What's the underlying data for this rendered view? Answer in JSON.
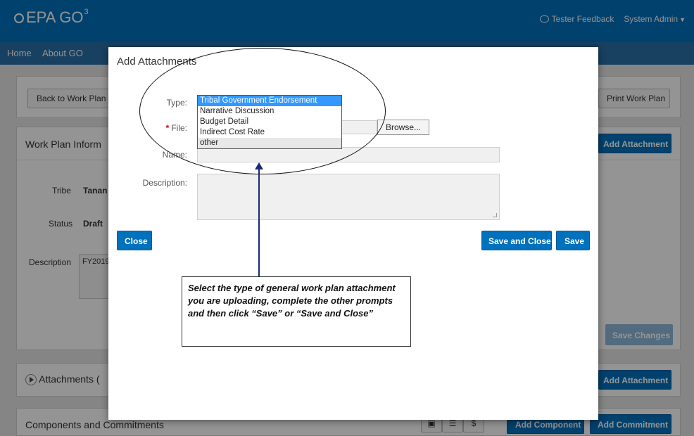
{
  "header": {
    "logo_text": "EPA GO",
    "logo_sup": "3",
    "feedback_label": "Tester Feedback",
    "user_label": "System Admin",
    "brand_color": "#0071bc"
  },
  "nav": {
    "home": "Home",
    "about": "About GO"
  },
  "background": {
    "back_button": "Back to Work Plan Li",
    "print_button": "Print Work Plan",
    "work_plan_title": "Work Plan Inform",
    "add_attachment_top": "Add Attachment",
    "tribe_label": "Tribe",
    "tribe_value": "Tanan",
    "status_label": "Status",
    "status_value": "Draft",
    "description_label": "Description",
    "description_value": "FY2019",
    "save_changes": "Save Changes",
    "attachments_title": "Attachments (",
    "add_attachment_bottom": "Add Attachment",
    "components_title": "Components and Commitments",
    "icon_labels": {
      "dollar": "$"
    },
    "add_component": "Add Component",
    "add_commitment": "Add Commitment"
  },
  "modal": {
    "title": "Add Attachments",
    "type_label": "Type:",
    "type_options": [
      "Tribal Government Endorsement",
      "Narrative Discussion",
      "Budget Detail",
      "Indirect Cost Rate",
      "other"
    ],
    "file_required_mark": "*",
    "file_label": "File:",
    "browse_button": "Browse...",
    "name_label": "Name:",
    "description_label": "Description:",
    "close_button": "Close",
    "save_close_button": "Save and Close",
    "save_button": "Save"
  },
  "callout": {
    "text": "Select the type of general work plan attachment you are uploading, complete the other prompts and then click “Save” or “Save and Close”"
  }
}
